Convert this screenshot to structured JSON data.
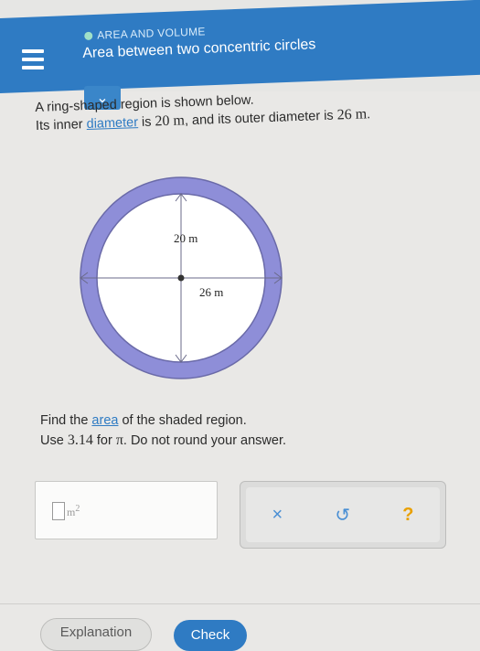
{
  "header": {
    "subject": "AREA AND VOLUME",
    "title": "Area between two concentric circles"
  },
  "problem": {
    "line1": "A ring-shaped region is shown below.",
    "line2_pre": "Its inner ",
    "line2_link": "diameter",
    "line2_mid": " is ",
    "inner_value": "20 m",
    "line2_post": ", and its outer diameter is ",
    "outer_value": "26 m",
    "line2_end": "."
  },
  "diagram": {
    "inner_label": "20 m",
    "outer_label": "26 m",
    "ring_color": "#8e8ed8",
    "inner_color": "#ffffff"
  },
  "question": {
    "line1_pre": "Find the ",
    "line1_link": "area",
    "line1_post": " of the shaded region.",
    "line2_pre": "Use ",
    "pi_value": "3.14",
    "line2_mid": " for ",
    "pi_symbol": "π",
    "line2_post": ". Do not round your answer."
  },
  "answer": {
    "value": "",
    "unit": "m",
    "exponent": "2"
  },
  "tools": {
    "clear_symbol": "×",
    "undo_symbol": "↺",
    "help_symbol": "?"
  },
  "footer": {
    "explanation_label": "Explanation",
    "check_label": "Check"
  }
}
